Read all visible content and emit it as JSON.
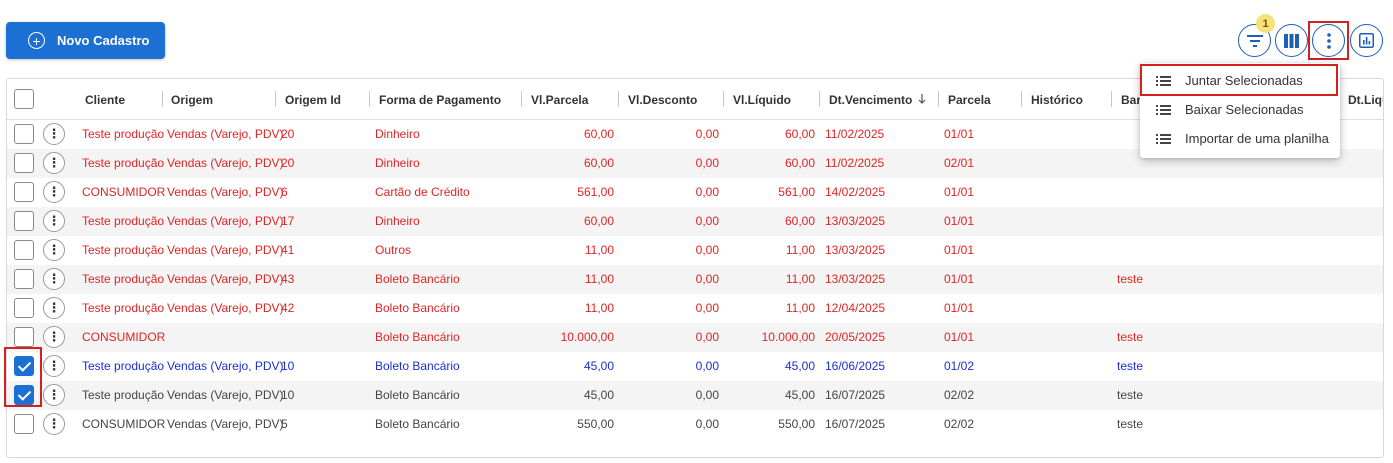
{
  "toolbar": {
    "new_button_label": "Novo Cadastro",
    "filter_badge_count": "1",
    "accent_color": "#1c6fd3"
  },
  "menu": {
    "items": [
      {
        "label": "Juntar Selecionadas"
      },
      {
        "label": "Baixar Selecionadas"
      },
      {
        "label": "Importar de uma planilha"
      }
    ]
  },
  "table": {
    "headers": [
      "Cliente",
      "Origem",
      "Origem Id",
      "Forma de Pagamento",
      "Vl.Parcela",
      "Vl.Desconto",
      "Vl.Líquido",
      "Dt.Vencimento",
      "Parcela",
      "Histórico",
      "Ban",
      "Dt.Liqu"
    ],
    "rows": [
      {
        "status": "red",
        "checked": false,
        "cliente": "Teste produção",
        "origem": "Vendas (Varejo, PDV)",
        "origem_id": "20",
        "forma": "Dinheiro",
        "parcela_valor": "60,00",
        "desconto": "0,00",
        "liquido": "60,00",
        "vencimento": "11/02/2025",
        "parcela": "01/01",
        "historico": ""
      },
      {
        "status": "red",
        "checked": false,
        "cliente": "Teste produção",
        "origem": "Vendas (Varejo, PDV)",
        "origem_id": "20",
        "forma": "Dinheiro",
        "parcela_valor": "60,00",
        "desconto": "0,00",
        "liquido": "60,00",
        "vencimento": "11/02/2025",
        "parcela": "02/01",
        "historico": ""
      },
      {
        "status": "red",
        "checked": false,
        "cliente": "CONSUMIDOR",
        "origem": "Vendas (Varejo, PDV)",
        "origem_id": "6",
        "forma": "Cartão de Crédito",
        "parcela_valor": "561,00",
        "desconto": "0,00",
        "liquido": "561,00",
        "vencimento": "14/02/2025",
        "parcela": "01/01",
        "historico": ""
      },
      {
        "status": "red",
        "checked": false,
        "cliente": "Teste produção",
        "origem": "Vendas (Varejo, PDV)",
        "origem_id": "17",
        "forma": "Dinheiro",
        "parcela_valor": "60,00",
        "desconto": "0,00",
        "liquido": "60,00",
        "vencimento": "13/03/2025",
        "parcela": "01/01",
        "historico": ""
      },
      {
        "status": "red",
        "checked": false,
        "cliente": "Teste produção",
        "origem": "Vendas (Varejo, PDV)",
        "origem_id": "41",
        "forma": "Outros",
        "parcela_valor": "11,00",
        "desconto": "0,00",
        "liquido": "11,00",
        "vencimento": "13/03/2025",
        "parcela": "01/01",
        "historico": ""
      },
      {
        "status": "red",
        "checked": false,
        "cliente": "Teste produção",
        "origem": "Vendas (Varejo, PDV)",
        "origem_id": "43",
        "forma": "Boleto Bancário",
        "parcela_valor": "11,00",
        "desconto": "0,00",
        "liquido": "11,00",
        "vencimento": "13/03/2025",
        "parcela": "01/01",
        "historico": "teste"
      },
      {
        "status": "red",
        "checked": false,
        "cliente": "Teste produção",
        "origem": "Vendas (Varejo, PDV)",
        "origem_id": "42",
        "forma": "Boleto Bancário",
        "parcela_valor": "11,00",
        "desconto": "0,00",
        "liquido": "11,00",
        "vencimento": "12/04/2025",
        "parcela": "01/01",
        "historico": ""
      },
      {
        "status": "red",
        "checked": false,
        "cliente": "CONSUMIDOR",
        "origem": "",
        "origem_id": "",
        "forma": "Boleto Bancário",
        "parcela_valor": "10.000,00",
        "desconto": "0,00",
        "liquido": "10.000,00",
        "vencimento": "20/05/2025",
        "parcela": "01/01",
        "historico": "teste"
      },
      {
        "status": "blue",
        "checked": true,
        "cliente": "Teste produção",
        "origem": "Vendas (Varejo, PDV)",
        "origem_id": "10",
        "forma": "Boleto Bancário",
        "parcela_valor": "45,00",
        "desconto": "0,00",
        "liquido": "45,00",
        "vencimento": "16/06/2025",
        "parcela": "01/02",
        "historico": "teste"
      },
      {
        "status": "gray",
        "checked": true,
        "cliente": "Teste produção",
        "origem": "Vendas (Varejo, PDV)",
        "origem_id": "10",
        "forma": "Boleto Bancário",
        "parcela_valor": "45,00",
        "desconto": "0,00",
        "liquido": "45,00",
        "vencimento": "16/07/2025",
        "parcela": "02/02",
        "historico": "teste"
      },
      {
        "status": "gray",
        "checked": false,
        "cliente": "CONSUMIDOR",
        "origem": "Vendas (Varejo, PDV)",
        "origem_id": "5",
        "forma": "Boleto Bancário",
        "parcela_valor": "550,00",
        "desconto": "0,00",
        "liquido": "550,00",
        "vencimento": "16/07/2025",
        "parcela": "02/02",
        "historico": "teste"
      }
    ]
  }
}
